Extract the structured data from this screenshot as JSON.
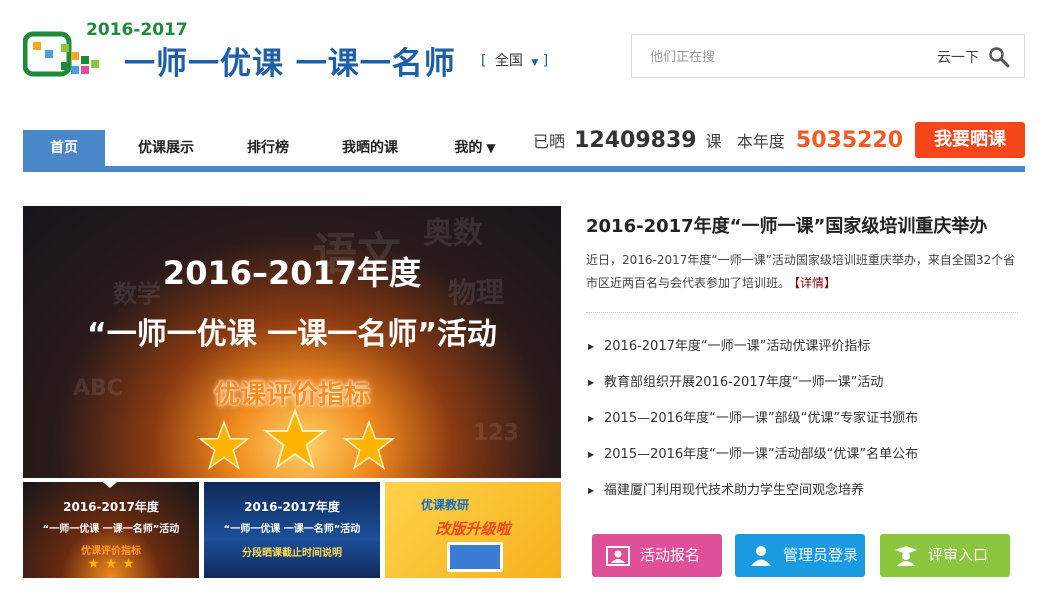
{
  "header": {
    "logo_year": "2016-2017",
    "slogan": "一师一优课  一课一名师",
    "region": {
      "open_bracket": "[",
      "name": "全国",
      "close_bracket": "]"
    },
    "search": {
      "placeholder": "他们正在搜",
      "shuffle_label": "云一下"
    }
  },
  "nav": {
    "tabs": [
      {
        "label": "首页",
        "active": true
      },
      {
        "label": "优课展示"
      },
      {
        "label": "排行榜"
      },
      {
        "label": "我晒的课"
      },
      {
        "label": "我的"
      }
    ],
    "stats": {
      "shared_label": "已晒",
      "shared_count": "12409839",
      "shared_unit": "课",
      "year_label": "本年度",
      "year_count": "5035220"
    },
    "share_button": "我要晒课"
  },
  "banner": {
    "line1": "2016–2017年度",
    "line2": "“一师一优课 一课一名师”活动",
    "line3": "优课评价指标",
    "thumbnails": [
      {
        "line1": "2016-2017年度",
        "line2": "“一师一优课 一课一名师”活动",
        "line3": "优课评价指标"
      },
      {
        "line1": "2016-2017年度",
        "line2": "“一师一优课 一课一名师”活动",
        "line3": "分段晒课截止时间说明"
      },
      {
        "line1": "优课教研",
        "line2": "改版升级啦"
      }
    ]
  },
  "news": {
    "title": "2016-2017年度“一师一课”国家级培训重庆举办",
    "summary": "近日，2016-2017年度“一师一课”活动国家级培训班重庆举办，来自全国32个省市区近两百名与会代表参加了培训班。",
    "detail_link": "【详情】",
    "items": [
      "2016-2017年度“一师一课”活动优课评价指标",
      "教育部组织开展2016-2017年度“一师一课”活动",
      "2015—2016年度“一师一课”部级“优课”专家证书颁布",
      "2015—2016年度“一师一课”活动部级“优课”名单公布",
      "福建厦门利用现代技术助力学生空间观念培养"
    ]
  },
  "actions": [
    {
      "label": "活动报名",
      "color": "#e0509a"
    },
    {
      "label": "管理员登录",
      "color": "#1a9ae0"
    },
    {
      "label": "评审入口",
      "color": "#8cc63f"
    }
  ],
  "colors": {
    "nav_blue": "#4a87c9",
    "accent_orange": "#f15a22",
    "share_red": "#f5461b"
  }
}
